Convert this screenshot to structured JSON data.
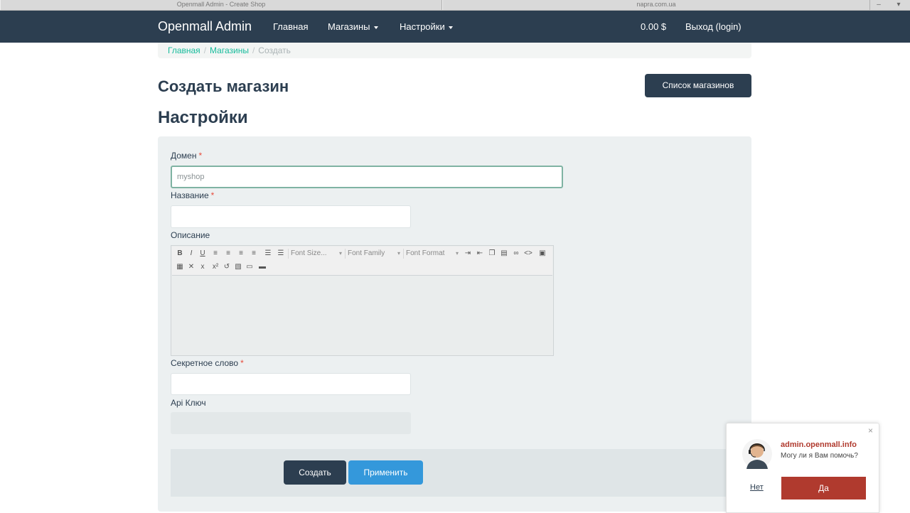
{
  "browser": {
    "tab1_title": "Openmall Admin - Create Shop",
    "tab2_title": "napra.com.ua"
  },
  "navbar": {
    "brand": "Openmall Admin",
    "links": [
      {
        "label": "Главная",
        "dropdown": false
      },
      {
        "label": "Магазины",
        "dropdown": true
      },
      {
        "label": "Настройки",
        "dropdown": true
      }
    ],
    "balance": "0.00 $",
    "logout": "Выход (login)"
  },
  "breadcrumb": {
    "items": [
      "Главная",
      "Магазины",
      "Создать"
    ],
    "separator": "/"
  },
  "page": {
    "title": "Создать магазин",
    "list_button": "Список магазинов",
    "section_title": "Настройки"
  },
  "form": {
    "domain": {
      "label": "Домен",
      "required": "*",
      "value": "myshop"
    },
    "name": {
      "label": "Название",
      "required": "*",
      "value": ""
    },
    "description": {
      "label": "Описание"
    },
    "secret": {
      "label": "Секретное слово",
      "required": "*",
      "value": ""
    },
    "api_key": {
      "label": "Api Ключ",
      "value": ""
    }
  },
  "editor": {
    "font_size": "Font Size...",
    "font_family": "Font Family",
    "font_format": "Font Format",
    "bold": "B",
    "italic": "I",
    "underline": "U",
    "subscript": "x",
    "superscript": "x²"
  },
  "actions": {
    "create": "Создать",
    "apply": "Применить"
  },
  "chat": {
    "site": "admin.openmall.info",
    "message": "Могу ли я Вам помочь?",
    "no": "Нет",
    "yes": "Да",
    "close": "×"
  },
  "colors": {
    "navbar": "#2c3e50",
    "accent": "#18bc9c",
    "primary": "#3498db",
    "danger": "#b03a2e"
  }
}
